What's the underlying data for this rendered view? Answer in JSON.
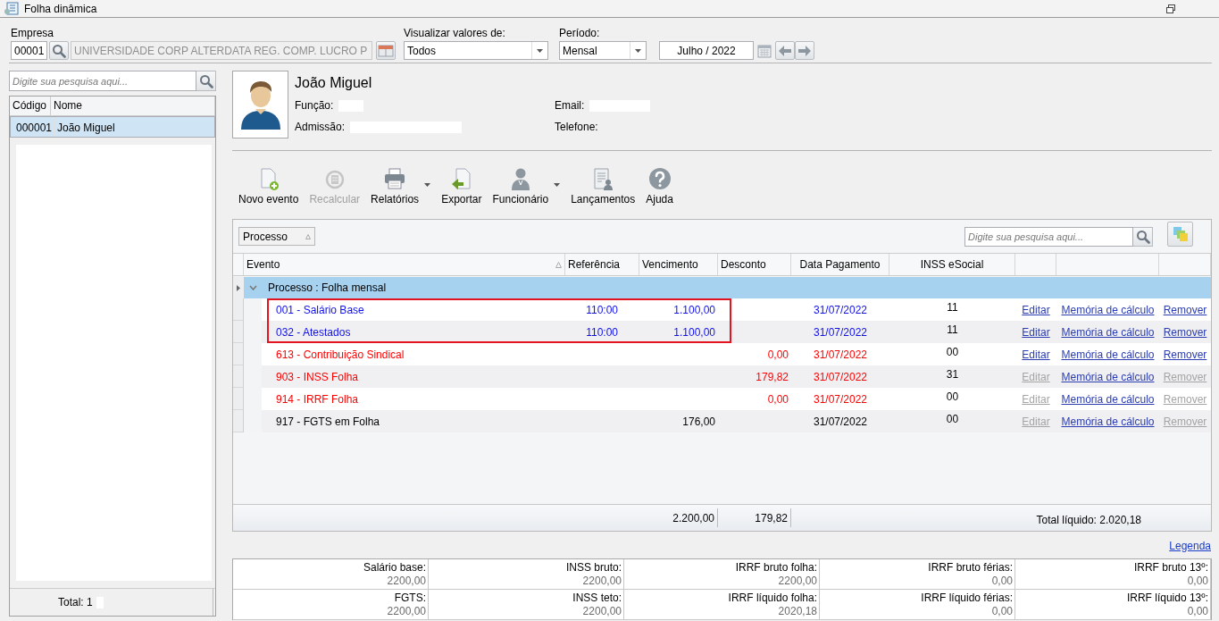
{
  "window": {
    "title": "Folha dinâmica"
  },
  "filters": {
    "empresa": {
      "label": "Empresa",
      "code": "00001",
      "name": "UNIVERSIDADE CORP ALTERDATA REG. COMP. LUCRO P"
    },
    "visualizar": {
      "label": "Visualizar valores de:",
      "value": "Todos"
    },
    "periodo": {
      "label": "Período:",
      "value": "Mensal"
    },
    "competencia": {
      "value": "Julho / 2022"
    }
  },
  "employee_list": {
    "search": {
      "placeholder": "Digite sua pesquisa aqui..."
    },
    "columns": [
      "Código",
      "Nome"
    ],
    "rows": [
      {
        "code": "000001",
        "name": "João Miguel",
        "selected": true
      }
    ],
    "footer": {
      "label": "Total: 1",
      "redacted": true
    }
  },
  "employee": {
    "name": "João Miguel",
    "fields": [
      {
        "label": "Função:",
        "redacted": true
      },
      {
        "label": "Email:",
        "redacted": true
      },
      {
        "label": "Admissão:",
        "redacted": true
      },
      {
        "label": "Telefone:",
        "redacted": false
      }
    ]
  },
  "toolbar": [
    {
      "label": "Novo evento",
      "kind": "new",
      "disabled": false,
      "dropdown": false
    },
    {
      "label": "Recalcular",
      "kind": "recalc",
      "disabled": true,
      "dropdown": false
    },
    {
      "label": "Relatórios",
      "kind": "print",
      "disabled": false,
      "dropdown": true
    },
    {
      "label": "Exportar",
      "kind": "export",
      "disabled": false,
      "dropdown": false
    },
    {
      "label": "Funcionário",
      "kind": "person",
      "disabled": false,
      "dropdown": true
    },
    {
      "label": "Lançamentos",
      "kind": "entries",
      "disabled": false,
      "dropdown": false
    },
    {
      "label": "Ajuda",
      "kind": "help",
      "disabled": false,
      "dropdown": false
    }
  ],
  "events_grid": {
    "group_by": "Processo",
    "search": {
      "placeholder": "Digite sua pesquisa aqui..."
    },
    "columns": [
      "Evento",
      "Referência",
      "Vencimento",
      "Desconto",
      "Data Pagamento",
      "INSS eSocial"
    ],
    "group": {
      "label": "Processo : Folha mensal",
      "expanded": true
    },
    "rows": [
      {
        "kind": "provento",
        "evento": "001 - Salário Base",
        "referencia": "110:00",
        "vencimento": "1.100,00",
        "data_pagamento": "31/07/2022",
        "inss_esocial": "11",
        "highlighted": true,
        "actions": [
          {
            "label": "Editar",
            "disabled": false
          },
          {
            "label": "Memória de cálculo",
            "disabled": false
          },
          {
            "label": "Remover",
            "disabled": false
          }
        ]
      },
      {
        "kind": "provento",
        "evento": "032 - Atestados",
        "referencia": "110:00",
        "vencimento": "1.100,00",
        "data_pagamento": "31/07/2022",
        "inss_esocial": "11",
        "highlighted": true,
        "actions": [
          {
            "label": "Editar",
            "disabled": false
          },
          {
            "label": "Memória de cálculo",
            "disabled": false
          },
          {
            "label": "Remover",
            "disabled": false
          }
        ]
      },
      {
        "kind": "desconto",
        "evento": "613 - Contribuição Sindical",
        "desconto": "0,00",
        "data_pagamento": "31/07/2022",
        "inss_esocial": "00",
        "highlighted": false,
        "actions": [
          {
            "label": "Editar",
            "disabled": false
          },
          {
            "label": "Memória de cálculo",
            "disabled": false
          },
          {
            "label": "Remover",
            "disabled": false
          }
        ]
      },
      {
        "kind": "desconto",
        "evento": "903 - INSS Folha",
        "desconto": "179,82",
        "data_pagamento": "31/07/2022",
        "inss_esocial": "31",
        "highlighted": false,
        "actions": [
          {
            "label": "Editar",
            "disabled": true
          },
          {
            "label": "Memória de cálculo",
            "disabled": false
          },
          {
            "label": "Remover",
            "disabled": true
          }
        ]
      },
      {
        "kind": "desconto",
        "evento": "914 - IRRF Folha",
        "desconto": "0,00",
        "data_pagamento": "31/07/2022",
        "inss_esocial": "00",
        "highlighted": false,
        "actions": [
          {
            "label": "Editar",
            "disabled": true
          },
          {
            "label": "Memória de cálculo",
            "disabled": false
          },
          {
            "label": "Remover",
            "disabled": true
          }
        ]
      },
      {
        "kind": "base",
        "evento": "917 - FGTS em Folha",
        "vencimento": "176,00",
        "data_pagamento": "31/07/2022",
        "inss_esocial": "00",
        "highlighted": false,
        "actions": [
          {
            "label": "Editar",
            "disabled": true
          },
          {
            "label": "Memória de cálculo",
            "disabled": false
          },
          {
            "label": "Remover",
            "disabled": true
          }
        ]
      }
    ],
    "totals": {
      "vencimento": "2.200,00",
      "desconto": "179,82",
      "liquido": "Total líquido: 2.020,18"
    }
  },
  "legend_link": "Legenda",
  "summary": [
    {
      "label": "Salário base:",
      "value": "2200,00"
    },
    {
      "label": "INSS bruto:",
      "value": "2200,00"
    },
    {
      "label": "IRRF bruto folha:",
      "value": "2200,00"
    },
    {
      "label": "IRRF bruto férias:",
      "value": "0,00"
    },
    {
      "label": "IRRF bruto 13º:",
      "value": "0,00"
    },
    {
      "label": "FGTS:",
      "value": "2200,00"
    },
    {
      "label": "INSS teto:",
      "value": "2200,00"
    },
    {
      "label": "IRRF líquido folha:",
      "value": "2020,18"
    },
    {
      "label": "IRRF líquido férias:",
      "value": "0,00"
    },
    {
      "label": "IRRF líquido 13º:",
      "value": "0,00"
    }
  ]
}
